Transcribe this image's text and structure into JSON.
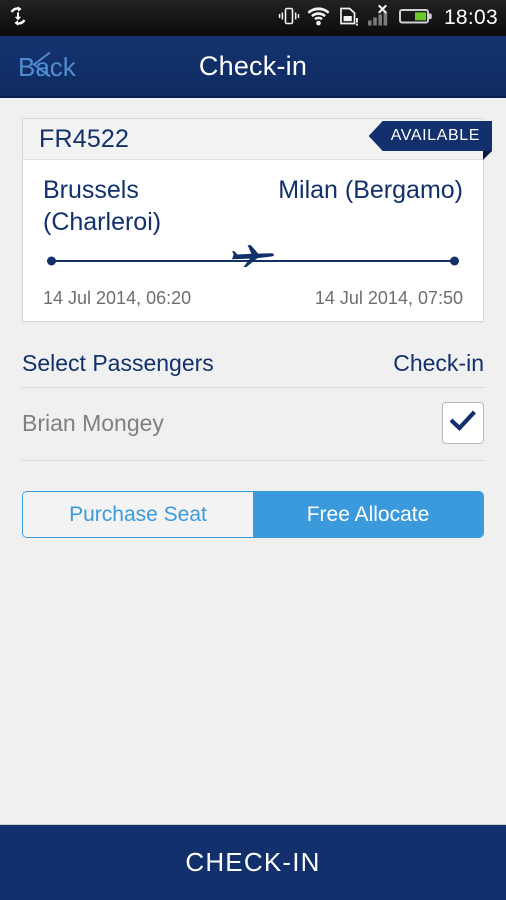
{
  "status_bar": {
    "sync_icon": "sync-download-icon",
    "vibrate_icon": "vibrate-icon",
    "wifi_icon": "wifi-icon",
    "sim_icon": "sim-card-alert-icon",
    "signal_icon": "signal-no-service-icon",
    "battery_icon": "battery-icon",
    "clock": "18:03"
  },
  "app_bar": {
    "back_label": "Back",
    "back_icon": "back-chevron-icon",
    "title": "Check-in"
  },
  "flight_card": {
    "flight_number": "FR4522",
    "status_badge": "AVAILABLE",
    "origin": "Brussels (Charleroi)",
    "destination": "Milan (Bergamo)",
    "plane_icon": "airplane-icon",
    "depart_datetime": "14 Jul 2014, 06:20",
    "arrive_datetime": "14 Jul 2014, 07:50"
  },
  "passengers_section": {
    "title": "Select Passengers",
    "action": "Check-in",
    "rows": [
      {
        "name": "Brian Mongey",
        "checked": true,
        "check_icon": "checkmark-icon"
      }
    ]
  },
  "seat_options": {
    "purchase_label": "Purchase Seat",
    "free_label": "Free Allocate",
    "selected": "Free Allocate"
  },
  "bottom_action": {
    "label": "CHECK-IN"
  },
  "colors": {
    "navy": "#12306b",
    "accent_blue": "#3a9adc",
    "back_link": "#4e8dd0",
    "page_bg": "#f0f0f0",
    "muted_text": "#808080",
    "time_text": "#6e6e6e"
  }
}
